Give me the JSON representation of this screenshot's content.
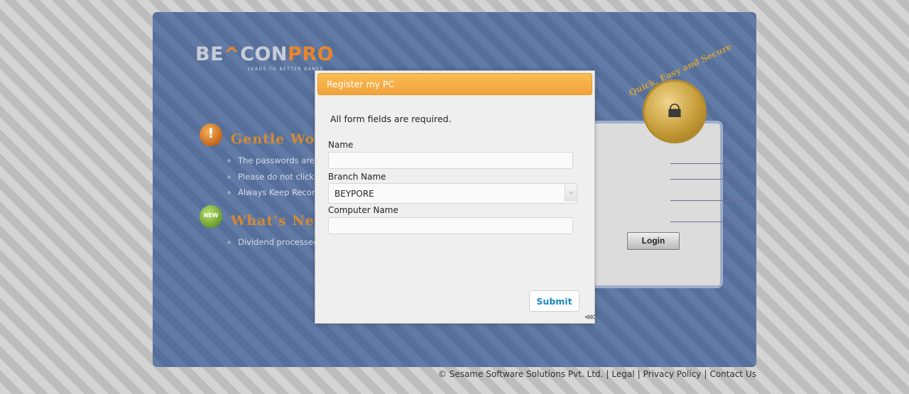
{
  "logo": {
    "part1": "BE",
    "part2": "CON",
    "part3": "PRO",
    "tagline": "LEADS TO BETTER BANKS"
  },
  "gentle": {
    "title": "Gentle Word",
    "items": [
      "The passwords are c",
      "Please do not click o",
      "Always Keep Records"
    ]
  },
  "news": {
    "title": "What's New",
    "icon_label": "NEW",
    "items": [
      "Dividend processed f"
    ]
  },
  "login": {
    "button_label": "Login",
    "badge_text": "Quick, Easy and Secure"
  },
  "dialog": {
    "title": "Register my PC",
    "required_note": "All form fields are required.",
    "name_label": "Name",
    "name_value": "",
    "branch_label": "Branch Name",
    "branch_value": "BEYPORE",
    "computer_label": "Computer Name",
    "computer_value": "",
    "submit_label": "Submit"
  },
  "footer": {
    "copyright": "© Sesame Software Solutions Pvt. Ltd.",
    "legal": "Legal",
    "privacy": "Privacy Policy",
    "contact": "Contact Us"
  },
  "colors": {
    "dialog_header": "#f5a73d",
    "panel": "#5a74a1",
    "accent_orange": "#e8862b",
    "submit_text": "#1a88c0"
  },
  "icons": [
    "exclamation-icon",
    "new-badge-icon",
    "padlock-icon",
    "chevron-down-icon",
    "resize-grip-icon",
    "caret-logo-icon"
  ]
}
